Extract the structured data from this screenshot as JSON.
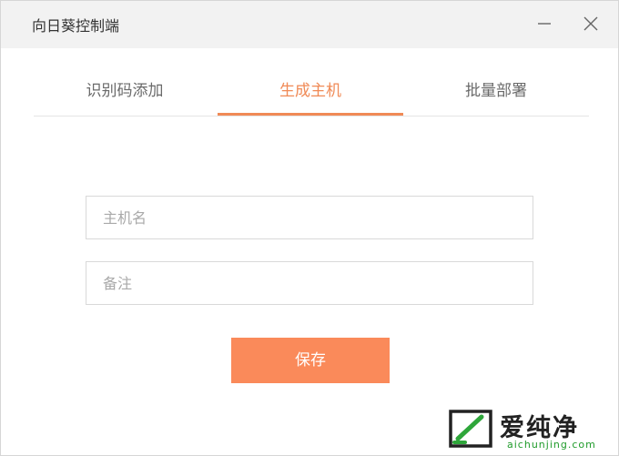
{
  "window": {
    "title": "向日葵控制端"
  },
  "tabs": [
    {
      "label": "识别码添加",
      "active": false
    },
    {
      "label": "生成主机",
      "active": true
    },
    {
      "label": "批量部署",
      "active": false
    }
  ],
  "form": {
    "host_name_placeholder": "主机名",
    "note_placeholder": "备注",
    "save_label": "保存"
  },
  "watermark": {
    "brand": "爱纯净",
    "url": "aichunjing.com"
  },
  "colors": {
    "accent": "#f08a56",
    "button": "#fa8a5a"
  },
  "icons": {
    "minimize": "minimize-icon",
    "close": "close-icon",
    "logo": "watermark-logo-icon"
  }
}
